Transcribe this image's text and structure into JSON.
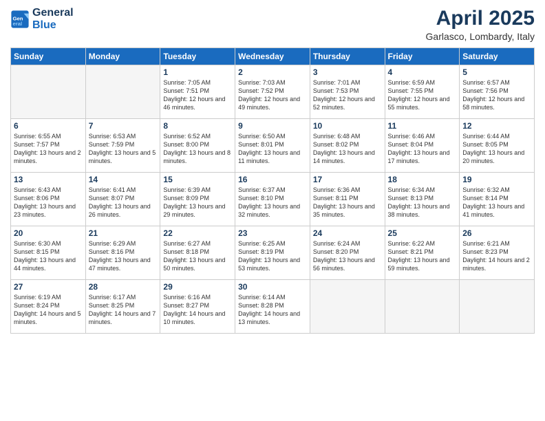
{
  "logo": {
    "line1": "General",
    "line2": "Blue"
  },
  "title": "April 2025",
  "subtitle": "Garlasco, Lombardy, Italy",
  "headers": [
    "Sunday",
    "Monday",
    "Tuesday",
    "Wednesday",
    "Thursday",
    "Friday",
    "Saturday"
  ],
  "weeks": [
    [
      {
        "day": "",
        "info": ""
      },
      {
        "day": "",
        "info": ""
      },
      {
        "day": "1",
        "info": "Sunrise: 7:05 AM\nSunset: 7:51 PM\nDaylight: 12 hours and 46 minutes."
      },
      {
        "day": "2",
        "info": "Sunrise: 7:03 AM\nSunset: 7:52 PM\nDaylight: 12 hours and 49 minutes."
      },
      {
        "day": "3",
        "info": "Sunrise: 7:01 AM\nSunset: 7:53 PM\nDaylight: 12 hours and 52 minutes."
      },
      {
        "day": "4",
        "info": "Sunrise: 6:59 AM\nSunset: 7:55 PM\nDaylight: 12 hours and 55 minutes."
      },
      {
        "day": "5",
        "info": "Sunrise: 6:57 AM\nSunset: 7:56 PM\nDaylight: 12 hours and 58 minutes."
      }
    ],
    [
      {
        "day": "6",
        "info": "Sunrise: 6:55 AM\nSunset: 7:57 PM\nDaylight: 13 hours and 2 minutes."
      },
      {
        "day": "7",
        "info": "Sunrise: 6:53 AM\nSunset: 7:59 PM\nDaylight: 13 hours and 5 minutes."
      },
      {
        "day": "8",
        "info": "Sunrise: 6:52 AM\nSunset: 8:00 PM\nDaylight: 13 hours and 8 minutes."
      },
      {
        "day": "9",
        "info": "Sunrise: 6:50 AM\nSunset: 8:01 PM\nDaylight: 13 hours and 11 minutes."
      },
      {
        "day": "10",
        "info": "Sunrise: 6:48 AM\nSunset: 8:02 PM\nDaylight: 13 hours and 14 minutes."
      },
      {
        "day": "11",
        "info": "Sunrise: 6:46 AM\nSunset: 8:04 PM\nDaylight: 13 hours and 17 minutes."
      },
      {
        "day": "12",
        "info": "Sunrise: 6:44 AM\nSunset: 8:05 PM\nDaylight: 13 hours and 20 minutes."
      }
    ],
    [
      {
        "day": "13",
        "info": "Sunrise: 6:43 AM\nSunset: 8:06 PM\nDaylight: 13 hours and 23 minutes."
      },
      {
        "day": "14",
        "info": "Sunrise: 6:41 AM\nSunset: 8:07 PM\nDaylight: 13 hours and 26 minutes."
      },
      {
        "day": "15",
        "info": "Sunrise: 6:39 AM\nSunset: 8:09 PM\nDaylight: 13 hours and 29 minutes."
      },
      {
        "day": "16",
        "info": "Sunrise: 6:37 AM\nSunset: 8:10 PM\nDaylight: 13 hours and 32 minutes."
      },
      {
        "day": "17",
        "info": "Sunrise: 6:36 AM\nSunset: 8:11 PM\nDaylight: 13 hours and 35 minutes."
      },
      {
        "day": "18",
        "info": "Sunrise: 6:34 AM\nSunset: 8:13 PM\nDaylight: 13 hours and 38 minutes."
      },
      {
        "day": "19",
        "info": "Sunrise: 6:32 AM\nSunset: 8:14 PM\nDaylight: 13 hours and 41 minutes."
      }
    ],
    [
      {
        "day": "20",
        "info": "Sunrise: 6:30 AM\nSunset: 8:15 PM\nDaylight: 13 hours and 44 minutes."
      },
      {
        "day": "21",
        "info": "Sunrise: 6:29 AM\nSunset: 8:16 PM\nDaylight: 13 hours and 47 minutes."
      },
      {
        "day": "22",
        "info": "Sunrise: 6:27 AM\nSunset: 8:18 PM\nDaylight: 13 hours and 50 minutes."
      },
      {
        "day": "23",
        "info": "Sunrise: 6:25 AM\nSunset: 8:19 PM\nDaylight: 13 hours and 53 minutes."
      },
      {
        "day": "24",
        "info": "Sunrise: 6:24 AM\nSunset: 8:20 PM\nDaylight: 13 hours and 56 minutes."
      },
      {
        "day": "25",
        "info": "Sunrise: 6:22 AM\nSunset: 8:21 PM\nDaylight: 13 hours and 59 minutes."
      },
      {
        "day": "26",
        "info": "Sunrise: 6:21 AM\nSunset: 8:23 PM\nDaylight: 14 hours and 2 minutes."
      }
    ],
    [
      {
        "day": "27",
        "info": "Sunrise: 6:19 AM\nSunset: 8:24 PM\nDaylight: 14 hours and 5 minutes."
      },
      {
        "day": "28",
        "info": "Sunrise: 6:17 AM\nSunset: 8:25 PM\nDaylight: 14 hours and 7 minutes."
      },
      {
        "day": "29",
        "info": "Sunrise: 6:16 AM\nSunset: 8:27 PM\nDaylight: 14 hours and 10 minutes."
      },
      {
        "day": "30",
        "info": "Sunrise: 6:14 AM\nSunset: 8:28 PM\nDaylight: 14 hours and 13 minutes."
      },
      {
        "day": "",
        "info": ""
      },
      {
        "day": "",
        "info": ""
      },
      {
        "day": "",
        "info": ""
      }
    ]
  ]
}
